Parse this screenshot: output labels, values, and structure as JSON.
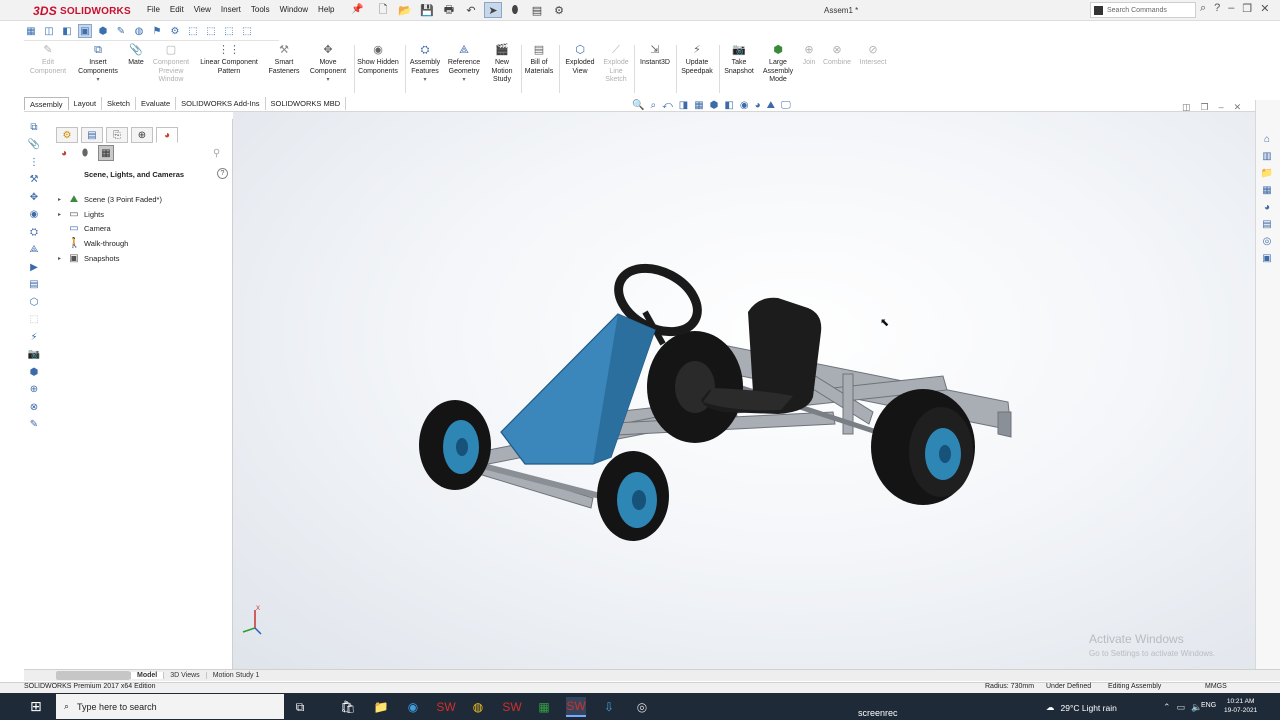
{
  "app": {
    "logo_prefix": "3DS",
    "logo_text": "SOLIDWORKS",
    "document_title": "Assem1 *"
  },
  "menu": [
    "File",
    "Edit",
    "View",
    "Insert",
    "Tools",
    "Window",
    "Help"
  ],
  "search": {
    "placeholder": "Search Commands"
  },
  "commands": [
    {
      "label": "Edit Component",
      "enabled": false
    },
    {
      "label": "Insert Components",
      "enabled": true
    },
    {
      "label": "Mate",
      "enabled": true
    },
    {
      "label": "Component Preview Window",
      "enabled": false
    },
    {
      "label": "Linear Component Pattern",
      "enabled": true
    },
    {
      "label": "Smart Fasteners",
      "enabled": true
    },
    {
      "label": "Move Component",
      "enabled": true
    },
    {
      "label": "Show Hidden Components",
      "enabled": true
    },
    {
      "label": "Assembly Features",
      "enabled": true
    },
    {
      "label": "Reference Geometry",
      "enabled": true
    },
    {
      "label": "New Motion Study",
      "enabled": true
    },
    {
      "label": "Bill of Materials",
      "enabled": true
    },
    {
      "label": "Exploded View",
      "enabled": true
    },
    {
      "label": "Explode Line Sketch",
      "enabled": false
    },
    {
      "label": "Instant3D",
      "enabled": true
    },
    {
      "label": "Update Speedpak",
      "enabled": true
    },
    {
      "label": "Take Snapshot",
      "enabled": true
    },
    {
      "label": "Large Assembly Mode",
      "enabled": true
    },
    {
      "label": "Join",
      "enabled": false
    },
    {
      "label": "Combine",
      "enabled": false
    },
    {
      "label": "Intersect",
      "enabled": false
    }
  ],
  "tabs": [
    "Assembly",
    "Layout",
    "Sketch",
    "Evaluate",
    "SOLIDWORKS Add-Ins",
    "SOLIDWORKS MBD"
  ],
  "feature_manager": {
    "heading": "Scene, Lights, and Cameras",
    "help": "?",
    "items": [
      {
        "label": "Scene (3 Point Faded*)",
        "expand": "▸"
      },
      {
        "label": "Lights",
        "expand": "▸"
      },
      {
        "label": "Camera",
        "expand": ""
      },
      {
        "label": "Walk-through",
        "expand": ""
      },
      {
        "label": "Snapshots",
        "expand": "▸"
      }
    ]
  },
  "triad": {
    "x_label": "X"
  },
  "watermark": {
    "line1": "Activate Windows",
    "line2": "Go to Settings to activate Windows."
  },
  "model_tabs": [
    "Model",
    "3D Views",
    "Motion Study 1"
  ],
  "status": {
    "edition": "SOLIDWORKS Premium 2017 x64 Edition",
    "radius": "Radius: 730mm",
    "definition": "Under Defined",
    "mode": "Editing Assembly",
    "units": "MMGS"
  },
  "taskbar": {
    "search_placeholder": "Type here to search",
    "recorder": "screenrec",
    "weather": "29°C  Light rain",
    "lang": "ENG",
    "time": "10:21 AM",
    "date": "19-07-2021"
  },
  "colors": {
    "cowl": "#2e7fb3",
    "tire": "#1b1b1b",
    "rim": "#2d86b4",
    "frame": "#9aa0a6",
    "brand": "#c8102e"
  }
}
